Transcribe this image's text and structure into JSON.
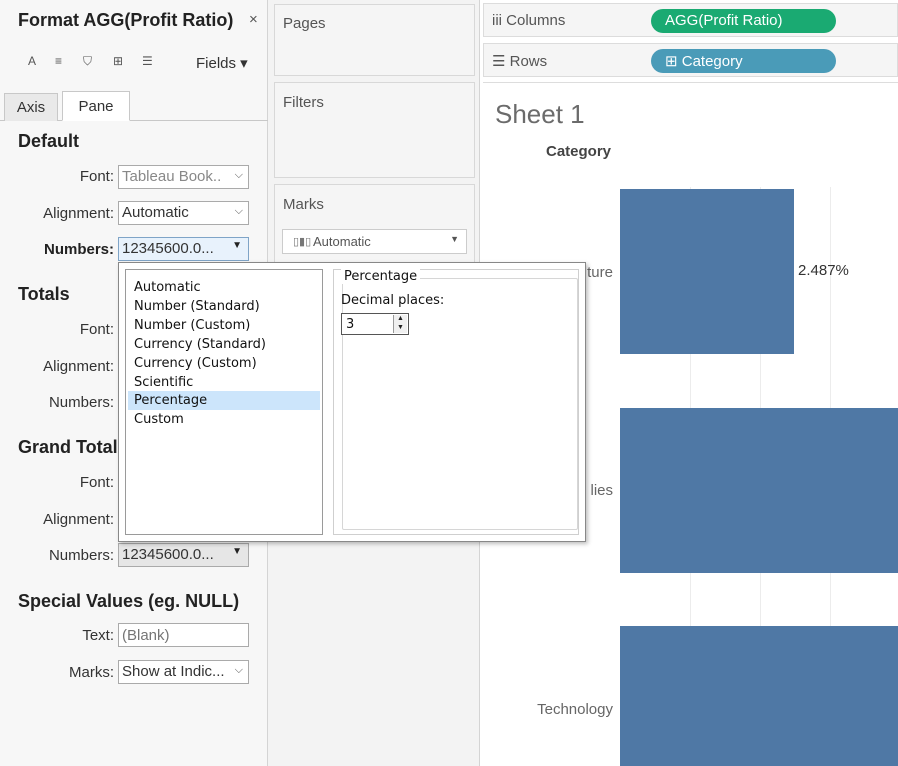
{
  "format_panel": {
    "title": "Format AGG(Profit Ratio)",
    "close": "×",
    "toolbar": {
      "font_icon": "A",
      "align_icon": "≡",
      "shading_icon": "⛉",
      "borders_icon": "⊞",
      "lines_icon": "☰",
      "fields_label": "Fields ▾"
    },
    "tabs": [
      "Axis",
      "Pane"
    ],
    "default": {
      "heading": "Default",
      "font_label": "Font:",
      "font_value": "Tableau Book..",
      "alignment_label": "Alignment:",
      "alignment_value": "Automatic",
      "numbers_label": "Numbers:",
      "numbers_value": "12345600.0..."
    },
    "totals": {
      "heading": "Totals",
      "font_label": "Font:",
      "alignment_label": "Alignment:",
      "numbers_label": "Numbers:"
    },
    "grand_totals": {
      "heading": "Grand Total",
      "font_label": "Font:",
      "alignment_label": "Alignment:",
      "numbers_label": "Numbers:",
      "numbers_value": "12345600.0..."
    },
    "special_values": {
      "heading": "Special Values (eg. NULL)",
      "text_label": "Text:",
      "text_placeholder": "(Blank)",
      "marks_label": "Marks:",
      "marks_value": "Show at Indic..."
    }
  },
  "shelves": {
    "pages": "Pages",
    "filters": "Filters",
    "marks": "Marks",
    "marks_type": "Automatic",
    "columns_label": "Columns",
    "columns_icon": "iii",
    "columns_pill": "AGG(Profit Ratio)",
    "rows_label": "Rows",
    "rows_icon": "☰",
    "rows_pill": "⊞ Category"
  },
  "sheet": {
    "title": "Sheet 1",
    "category_header": "Category",
    "row_labels": [
      "ture",
      "lies",
      "Technology"
    ],
    "bar_label": "2.487%"
  },
  "number_format_popup": {
    "options": [
      "Automatic",
      "Number (Standard)",
      "Number (Custom)",
      "Currency (Standard)",
      "Currency (Custom)",
      "Scientific",
      "Percentage",
      "Custom"
    ],
    "selected": "Percentage",
    "group_title": "Percentage",
    "decimal_label": "Decimal places:",
    "decimal_value": "3"
  },
  "colors": {
    "bar": "#4f78a5",
    "columns_pill": "#1aaa72",
    "rows_pill": "#4a9bb8",
    "selection": "#cce5fb"
  }
}
